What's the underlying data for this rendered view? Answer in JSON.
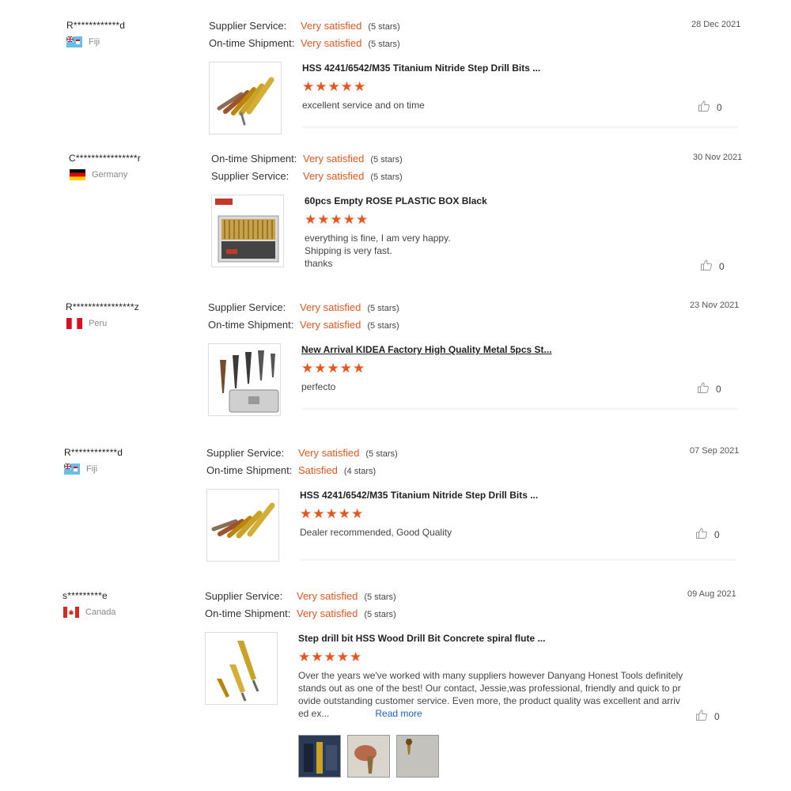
{
  "reviews": [
    {
      "user": "R************d",
      "country": "Fiji",
      "flag": "fiji",
      "date": "28 Dec 2021",
      "ratings": [
        {
          "label": "Supplier Service:",
          "value": "Very satisfied",
          "count": "(5 stars)"
        },
        {
          "label": "On-time Shipment:",
          "value": "Very satisfied",
          "count": "(5 stars)"
        }
      ],
      "product": "HSS 4241/6542/M35 Titanium Nitride Step Drill Bits ...",
      "stars": 5,
      "comment": [
        "excellent service and on time"
      ],
      "likes": "0"
    },
    {
      "user": "C****************r",
      "country": "Germany",
      "flag": "germany",
      "date": "30 Nov 2021",
      "ratings": [
        {
          "label": "On-time Shipment:",
          "value": "Very satisfied",
          "count": "(5 stars)"
        },
        {
          "label": "Supplier Service:",
          "value": "Very satisfied",
          "count": "(5 stars)"
        }
      ],
      "product": "60pcs Empty ROSE PLASTIC BOX Black",
      "stars": 5,
      "comment": [
        "everything is fine, I am very happy.",
        "Shipping is very fast.",
        "thanks"
      ],
      "likes": "0"
    },
    {
      "user": "R****************z",
      "country": "Peru",
      "flag": "peru",
      "date": "23 Nov 2021",
      "ratings": [
        {
          "label": "Supplier Service:",
          "value": "Very satisfied",
          "count": "(5 stars)"
        },
        {
          "label": "On-time Shipment:",
          "value": "Very satisfied",
          "count": "(5 stars)"
        }
      ],
      "product": "New Arrival KIDEA Factory High Quality Metal 5pcs St...",
      "stars": 5,
      "comment": [
        "perfecto"
      ],
      "likes": "0"
    },
    {
      "user": "R************d",
      "country": "Fiji",
      "flag": "fiji",
      "date": "07 Sep 2021",
      "ratings": [
        {
          "label": "Supplier Service:",
          "value": "Very satisfied",
          "count": "(5 stars)"
        },
        {
          "label": "On-time Shipment:",
          "value": "Satisfied",
          "count": "(4 stars)"
        }
      ],
      "product": "HSS 4241/6542/M35 Titanium Nitride Step Drill Bits ...",
      "stars": 5,
      "comment": [
        "Dealer recommended, Good Quality"
      ],
      "likes": "0"
    },
    {
      "user": "s*********e",
      "country": "Canada",
      "flag": "canada",
      "date": "09 Aug 2021",
      "ratings": [
        {
          "label": "Supplier Service:",
          "value": "Very satisfied",
          "count": "(5 stars)"
        },
        {
          "label": "On-time Shipment:",
          "value": "Very satisfied",
          "count": "(5 stars)"
        }
      ],
      "product": "Step drill bit HSS Wood Drill Bit Concrete spiral flute ...",
      "stars": 5,
      "comment": [
        "Over the years we've worked with many suppliers however Danyang Honest Tools definitely",
        "stands out as one of the best! Our contact, Jessie,was professional, friendly and quick to pr",
        "ovide outstanding customer service. Even more, the product quality was excellent and arriv",
        "ed ex..."
      ],
      "read_more": "Read more",
      "likes": "0"
    }
  ],
  "colors": {
    "accent": "#e8561c",
    "link": "#1565c0"
  }
}
